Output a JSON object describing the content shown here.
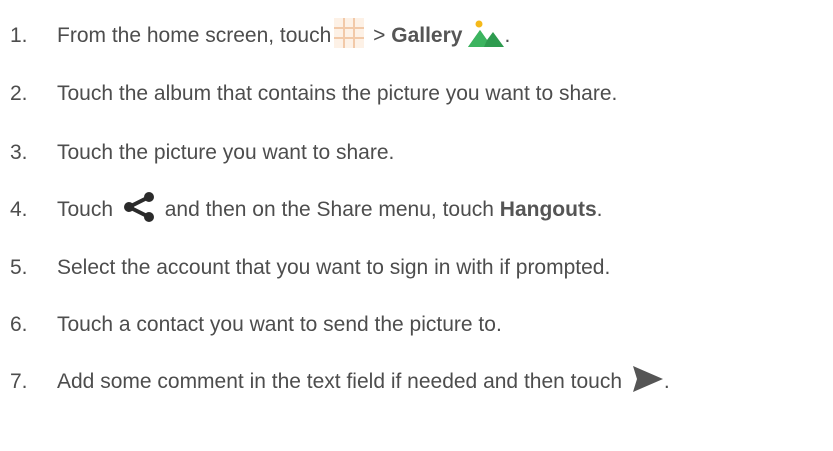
{
  "steps": [
    {
      "number": "1.",
      "text_a": "From the home screen, touch ",
      "text_b": " > ",
      "bold": "Gallery",
      "text_c": "."
    },
    {
      "number": "2.",
      "text": "Touch the album that contains the picture you want to share."
    },
    {
      "number": "3.",
      "text": "Touch the picture you want to share."
    },
    {
      "number": "4.",
      "text_a": "Touch ",
      "text_b": " and then on the Share menu, touch ",
      "bold": "Hangouts",
      "text_c": "."
    },
    {
      "number": "5.",
      "text": "Select the account that you want to sign in with if prompted."
    },
    {
      "number": "6.",
      "text": "Touch a contact you want to send the picture to."
    },
    {
      "number": "7.",
      "text_a": "Add some comment in the text field if needed and then touch ",
      "text_c": "."
    }
  ],
  "icons": {
    "apps": "apps-grid-icon",
    "gallery": "gallery-icon",
    "share": "share-icon",
    "send": "send-icon"
  },
  "colors": {
    "text": "#4d4d4d",
    "gallery_green": "#2e9b4f",
    "gallery_yellow": "#f5b91a",
    "grid_peach": "#f2c9a8",
    "icon_dark": "#2b2b2b",
    "send_gray": "#555555"
  }
}
